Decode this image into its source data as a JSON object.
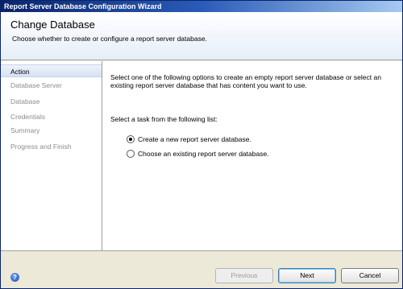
{
  "window": {
    "title": "Report Server Database Configuration Wizard"
  },
  "header": {
    "title": "Change Database",
    "subtitle": "Choose whether to create or configure a report server database."
  },
  "sidebar": {
    "items": [
      {
        "label": "Action",
        "active": true
      },
      {
        "label": "Database Server",
        "active": false
      },
      {
        "label": "Database",
        "active": false
      },
      {
        "label": "Credentials",
        "active": false
      },
      {
        "label": "Summary",
        "active": false
      },
      {
        "label": "Progress and Finish",
        "active": false
      }
    ]
  },
  "main": {
    "intro": "Select one of the following options to create an empty report server database or select an existing report server database that has content you want to use.",
    "task_label": "Select a task from the following list:",
    "options": [
      {
        "label": "Create a new report server database.",
        "selected": true
      },
      {
        "label": "Choose an existing report server database.",
        "selected": false
      }
    ]
  },
  "footer": {
    "help_icon": "help-icon",
    "previous_label": "Previous",
    "next_label": "Next",
    "cancel_label": "Cancel"
  }
}
